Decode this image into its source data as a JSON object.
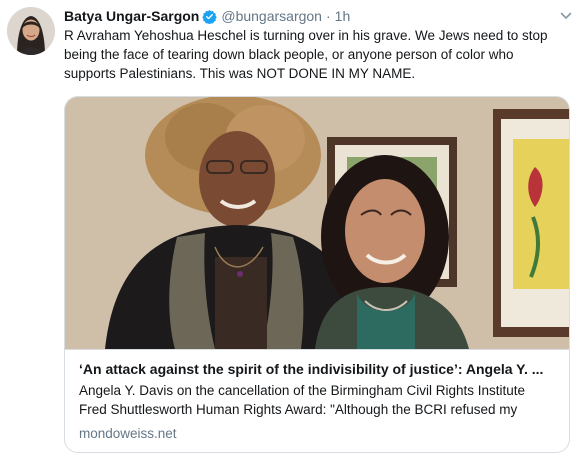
{
  "tweet": {
    "author": {
      "display_name": "Batya Ungar-Sargon",
      "handle": "@bungarsargon",
      "verified": true
    },
    "separator": "·",
    "time": "1h",
    "text_lines": [
      "R Avraham Yehoshua Heschel is turning over in his grave. We Jews need to stop",
      "being the face of tearing down black people, or anyone person of color who",
      "supports Palestinians. This was NOT DONE IN MY NAME."
    ],
    "card": {
      "title": "‘An attack against the spirit of the indivisibility of justice’: Angela Y. ...",
      "description_lines": [
        "Angela Y. Davis on the cancellation of the Birmingham Civil Rights Institute",
        "Fred Shuttlesworth Human Rights Award: \"Although the BCRI refused my"
      ],
      "domain": "mondoweiss.net"
    }
  },
  "colors": {
    "verified_blue": "#1da1f2",
    "secondary_text": "#657786",
    "card_border": "#d7dde2"
  },
  "icons": {
    "verified": "verified-badge-icon",
    "caret": "chevron-down-icon"
  }
}
